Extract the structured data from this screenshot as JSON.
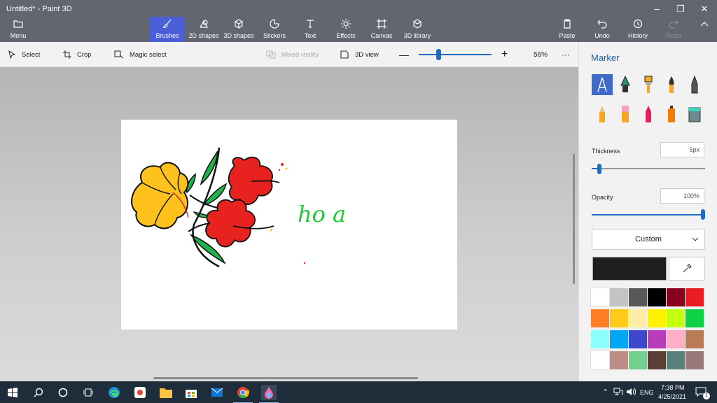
{
  "window": {
    "title": "Untitled* - Paint 3D"
  },
  "ribbon": {
    "menu": "Menu",
    "tabs": [
      "Brushes",
      "2D shapes",
      "3D shapes",
      "Stickers",
      "Text",
      "Effects",
      "Canvas",
      "3D library"
    ],
    "active_tab": "Brushes",
    "actions": [
      "Paste",
      "Undo",
      "History",
      "Redo"
    ]
  },
  "toolbar": {
    "select": "Select",
    "crop": "Crop",
    "magic_select": "Magic select",
    "mixed_reality": "Mixed reality",
    "view_3d": "3D view",
    "zoom": "56%",
    "more": "···"
  },
  "panel": {
    "title": "Marker",
    "brushes": [
      "marker",
      "calligraphy-pen",
      "oil-brush",
      "watercolor",
      "pixel-pen",
      "pencil",
      "eraser",
      "crayon",
      "spray-can",
      "fill"
    ],
    "thickness_label": "Thickness",
    "thickness_value": "5px",
    "thickness_level": 0.05,
    "opacity_label": "Opacity",
    "opacity_value": "100%",
    "opacity_level": 1.0,
    "color_mode": "Custom",
    "current_color": "#1e1e1e",
    "palette": [
      "#ffffff",
      "#c3c3c3",
      "#585858",
      "#000000",
      "#88001b",
      "#ec1c24",
      "#ff7f27",
      "#ffca18",
      "#fdeca6",
      "#fff200",
      "#c4ff0e",
      "#0ed145",
      "#8cfffb",
      "#00a8f3",
      "#3f48cc",
      "#b83dba",
      "#ffaec8",
      "#b97a56",
      "#ffffff",
      "#bd8c87",
      "#72cf8d",
      "#5b3e35",
      "#5a7e7a",
      "#9a7a79"
    ]
  },
  "canvas": {
    "handwriting": "ho a"
  },
  "taskbar": {
    "language": "ENG",
    "time": "7:38 PM",
    "date": "4/25/2021",
    "notification_count": "1"
  }
}
